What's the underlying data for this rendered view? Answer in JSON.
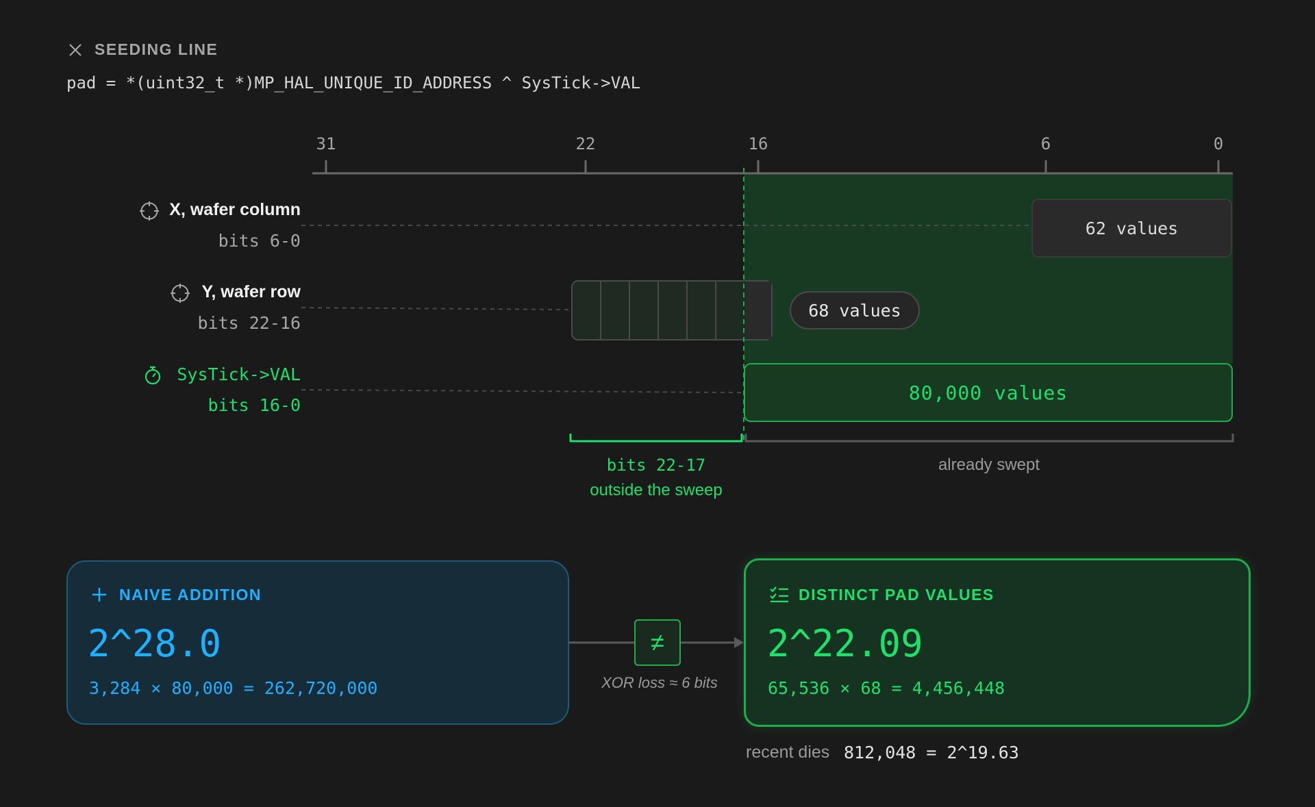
{
  "header": {
    "label": "SEEDING LINE",
    "code": "pad = *(uint32_t *)MP_HAL_UNIQUE_ID_ADDRESS ^ SysTick->VAL"
  },
  "axis": {
    "ticks": [
      "31",
      "22",
      "16",
      "6",
      "0"
    ]
  },
  "rows": [
    {
      "title": "X, wafer column",
      "bits": "bits 6-0",
      "value": "62 values",
      "icon": "crosshair-icon"
    },
    {
      "title": "Y, wafer row",
      "bits": "bits 22-16",
      "value": "68 values",
      "icon": "crosshair-icon"
    },
    {
      "title": "SysTick->VAL",
      "bits": "bits 16-0",
      "value": "80,000 values",
      "icon": "stopwatch-icon"
    }
  ],
  "brackets": {
    "outside_bits": "bits 22-17",
    "outside_text": "outside the sweep",
    "swept": "already swept"
  },
  "naive": {
    "title": "NAIVE ADDITION",
    "big": "2^28.0",
    "equation": "3,284 × 80,000 = 262,720,000",
    "icon": "plus-icon"
  },
  "connector": {
    "symbol": "≠",
    "label": "XOR loss ≈ 6 bits"
  },
  "distinct": {
    "title": "DISTINCT PAD VALUES",
    "big": "2^22.09",
    "equation": "65,536 × 68 = 4,456,448",
    "icon": "checklist-icon"
  },
  "recent": {
    "label": "recent dies",
    "value": "812,048 = 2^19.63"
  },
  "colors": {
    "background": "#1a1a1a",
    "green": "#1fe06a",
    "blue": "#1fb0ff",
    "swept_region": "#1a3a22"
  }
}
